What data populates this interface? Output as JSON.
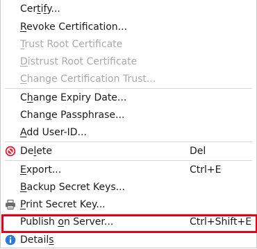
{
  "menu": {
    "items": [
      {
        "label": "Certify...",
        "mnemonic": "i",
        "enabled": true
      },
      {
        "label": "Revoke Certification...",
        "mnemonic": "R",
        "enabled": true
      },
      {
        "label": "Trust Root Certificate",
        "mnemonic": "T",
        "enabled": false
      },
      {
        "label": "Distrust Root Certificate",
        "mnemonic": "D",
        "enabled": false
      },
      {
        "label": "Change Certification Trust...",
        "mnemonic": "C",
        "enabled": false
      },
      {
        "label": "Change Expiry Date...",
        "mnemonic": "h",
        "enabled": true
      },
      {
        "label": "Change Passphrase...",
        "mnemonic": "g",
        "enabled": true
      },
      {
        "label": "Add User-ID...",
        "mnemonic": "A",
        "enabled": true
      },
      {
        "label": "Delete",
        "mnemonic": "l",
        "shortcut": "Del",
        "icon": "delete-icon",
        "enabled": true
      },
      {
        "label": "Export...",
        "mnemonic": "E",
        "shortcut": "Ctrl+E",
        "enabled": true
      },
      {
        "label": "Backup Secret Keys...",
        "mnemonic": "B",
        "enabled": true
      },
      {
        "label": "Print Secret Key...",
        "mnemonic": "P",
        "icon": "printer-icon",
        "enabled": true
      },
      {
        "label": "Publish on Server...",
        "mnemonic": "o",
        "shortcut": "Ctrl+Shift+E",
        "enabled": true,
        "highlighted": true
      },
      {
        "label": "Details",
        "mnemonic": "s",
        "icon": "info-icon",
        "enabled": true
      }
    ]
  },
  "colors": {
    "highlight_border": "#e3001b",
    "disabled_text": "#a9a9a9",
    "delete_icon": "#e0182d",
    "info_icon": "#2b7bd6"
  }
}
